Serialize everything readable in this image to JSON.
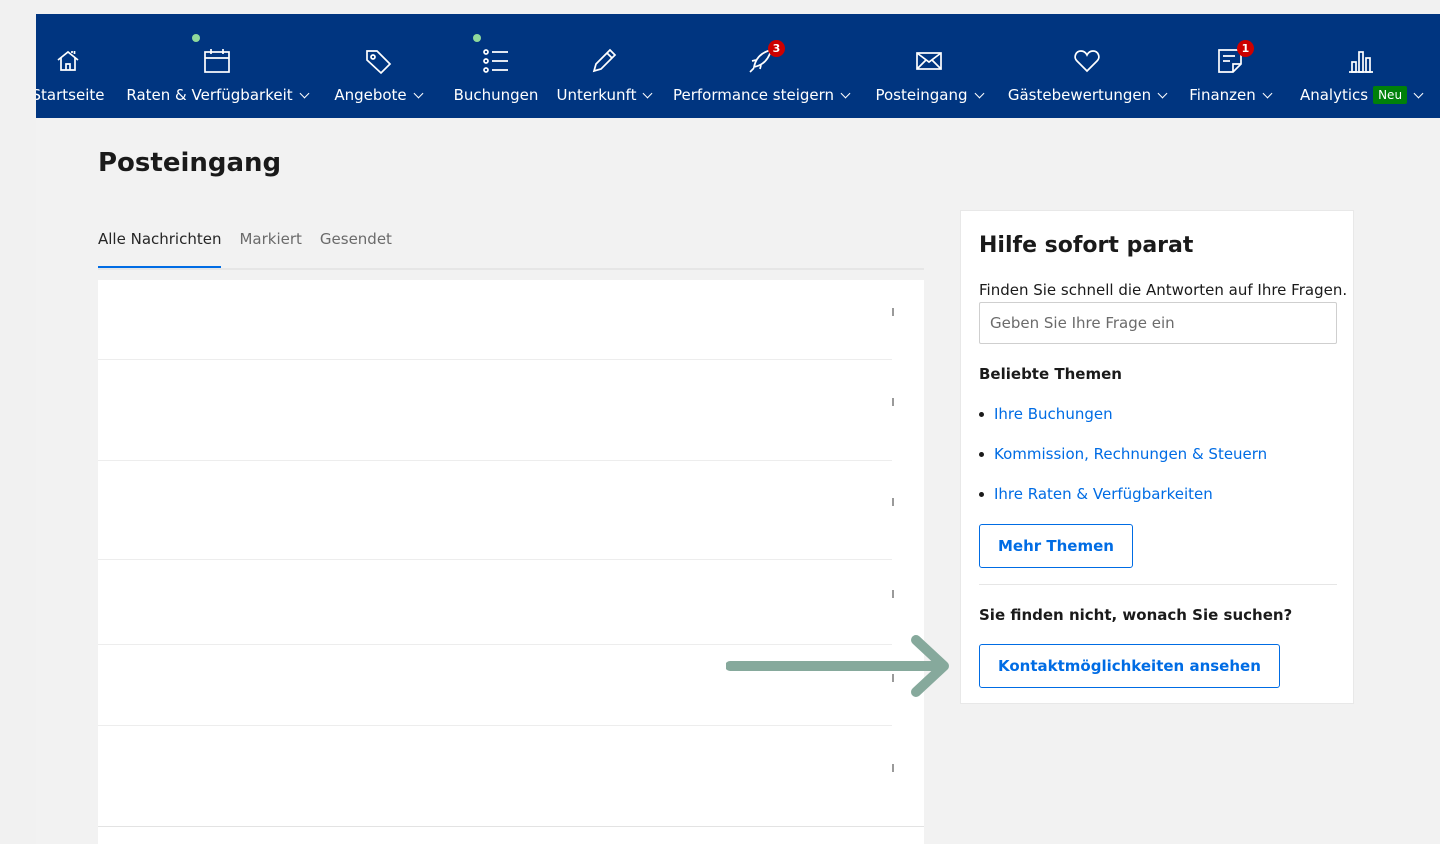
{
  "nav": {
    "items": [
      {
        "label": "Startseite",
        "dropdown": false,
        "icon": "house-icon"
      },
      {
        "label": "Raten & Verfügbarkeit",
        "dropdown": true,
        "icon": "calendar-icon",
        "indicator": "green-dot"
      },
      {
        "label": "Angebote",
        "dropdown": true,
        "icon": "tag-icon"
      },
      {
        "label": "Buchungen",
        "dropdown": false,
        "icon": "list-icon",
        "indicator": "green-dot"
      },
      {
        "label": "Unterkunft",
        "dropdown": true,
        "icon": "pencil-icon"
      },
      {
        "label": "Performance steigern",
        "dropdown": true,
        "icon": "rocket-icon",
        "badge": "3"
      },
      {
        "label": "Posteingang",
        "dropdown": true,
        "icon": "envelope-icon"
      },
      {
        "label": "Gästebewertungen",
        "dropdown": true,
        "icon": "heart-icon"
      },
      {
        "label": "Finanzen",
        "dropdown": true,
        "icon": "document-icon",
        "badge": "1"
      },
      {
        "label": "Analytics",
        "dropdown": true,
        "icon": "bar-chart-icon",
        "new_badge": "Neu"
      }
    ]
  },
  "page": {
    "title": "Posteingang",
    "tabs": [
      {
        "label": "Alle Nachrichten",
        "active": true
      },
      {
        "label": "Markiert",
        "active": false
      },
      {
        "label": "Gesendet",
        "active": false
      }
    ]
  },
  "help": {
    "title": "Hilfe sofort parat",
    "subtitle": "Finden Sie schnell die Antworten auf Ihre Fragen.",
    "search_placeholder": "Geben Sie Ihre Frage ein",
    "topics_heading": "Beliebte Themen",
    "topics": [
      "Ihre Buchungen",
      "Kommission, Rechnungen & Steuern",
      "Ihre Raten & Verfügbarkeiten"
    ],
    "more_button": "Mehr Themen",
    "not_found": "Sie finden nicht, wonach Sie suchen?",
    "contact_button": "Kontaktmöglichkeiten ansehen"
  },
  "colors": {
    "nav_bg": "#003580",
    "link": "#006ce4",
    "badge_red": "#cc0000",
    "badge_green": "#008009",
    "arrow": "#86a99c"
  }
}
